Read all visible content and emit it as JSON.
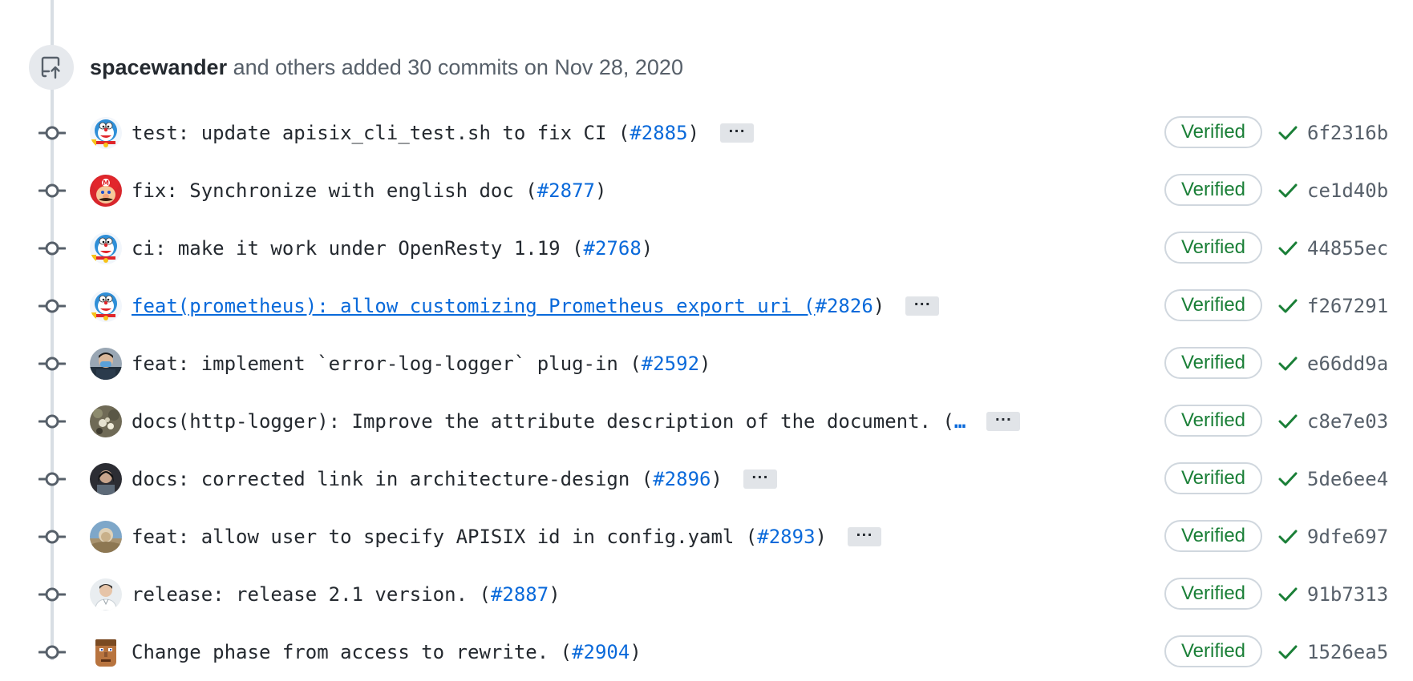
{
  "event": {
    "author": "spacewander",
    "summary": "and others added 30 commits on Nov 28, 2020",
    "icon": "repo-push-icon"
  },
  "colors": {
    "verified": "#1a7f37",
    "link": "#0969da",
    "sha": "#57606a"
  },
  "commits": [
    {
      "msg": "test: update apisix_cli_test.sh to fix CI (",
      "pr": "#2885",
      "close": ")",
      "expander": "···",
      "verified": "Verified",
      "sha": "6f2316b",
      "avatar": "doraemon"
    },
    {
      "msg": "fix: Synchronize with english doc (",
      "pr": "#2877",
      "close": ")",
      "verified": "Verified",
      "sha": "ce1d40b",
      "avatar": "mario"
    },
    {
      "msg": "ci: make it work under OpenResty 1.19 (",
      "pr": "#2768",
      "close": ")",
      "verified": "Verified",
      "sha": "44855ec",
      "avatar": "doraemon"
    },
    {
      "msg": "feat(prometheus): allow customizing Prometheus export uri (",
      "pr": "#2826",
      "close": ")",
      "expander": "···",
      "verified": "Verified",
      "sha": "f267291",
      "avatar": "doraemon",
      "linked": true
    },
    {
      "msg": "feat: implement `error-log-logger` plug-in (",
      "pr": "#2592",
      "close": ")",
      "verified": "Verified",
      "sha": "e66dd9a",
      "avatar": "person-mask"
    },
    {
      "msg": "docs(http-logger): Improve the attribute description of the document. (",
      "ellipsis": "…",
      "expander": "···",
      "verified": "Verified",
      "sha": "c8e7e03",
      "avatar": "person-flowers",
      "truncated": true
    },
    {
      "msg": "docs: corrected link in architecture-design (",
      "pr": "#2896",
      "close": ")",
      "expander": "···",
      "verified": "Verified",
      "sha": "5de6ee4",
      "avatar": "person-dark"
    },
    {
      "msg": "feat: allow user to specify APISIX id in config.yaml (",
      "pr": "#2893",
      "close": ")",
      "expander": "···",
      "verified": "Verified",
      "sha": "9dfe697",
      "avatar": "person-outdoor"
    },
    {
      "msg": "release: release 2.1 version. (",
      "pr": "#2887",
      "close": ")",
      "verified": "Verified",
      "sha": "91b7313",
      "avatar": "person-white"
    },
    {
      "msg": "Change phase from access to rewrite. (",
      "pr": "#2904",
      "close": ")",
      "verified": "Verified",
      "sha": "1526ea5",
      "avatar": "doom-guy"
    }
  ]
}
